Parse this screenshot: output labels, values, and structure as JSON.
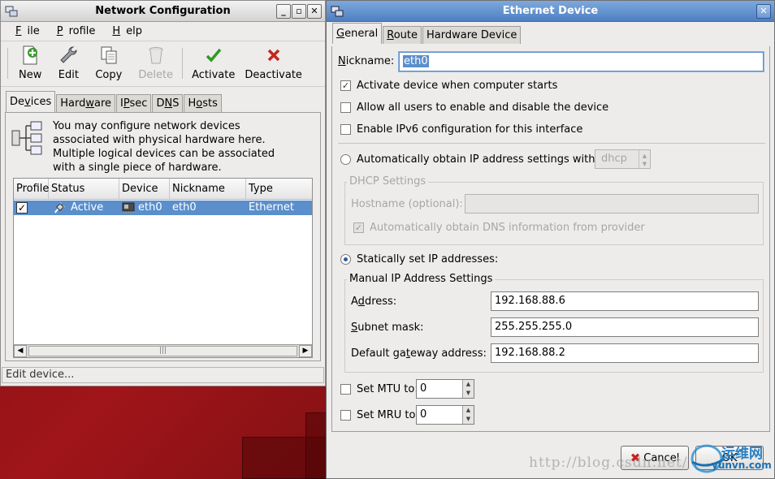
{
  "nc_window": {
    "title": "Network Configuration",
    "menu": [
      "File",
      "Profile",
      "Help"
    ],
    "toolbar": [
      {
        "label": "New",
        "icon": "new-plus-icon",
        "enabled": true
      },
      {
        "label": "Edit",
        "icon": "wrench-icon",
        "enabled": true
      },
      {
        "label": "Copy",
        "icon": "copy-icon",
        "enabled": true
      },
      {
        "label": "Delete",
        "icon": "trash-icon",
        "enabled": false
      },
      {
        "label": "Activate",
        "icon": "checkmark-icon",
        "enabled": true
      },
      {
        "label": "Deactivate",
        "icon": "red-x-icon",
        "enabled": true
      }
    ],
    "tabs": [
      "Devices",
      "Hardware",
      "IPsec",
      "DNS",
      "Hosts"
    ],
    "active_tab": "Devices",
    "info_text": "You may configure network devices\nassociated with physical hardware here.\nMultiple logical devices can be associated\nwith a single piece of hardware.",
    "columns": [
      "Profile",
      "Status",
      "Device",
      "Nickname",
      "Type"
    ],
    "rows": [
      {
        "profile_checked": true,
        "status": "Active",
        "device": "eth0",
        "nickname": "eth0",
        "type": "Ethernet"
      }
    ],
    "scroll_grip": "|||",
    "status_text": "Edit device..."
  },
  "eth_dialog": {
    "title": "Ethernet Device",
    "tabs": [
      "General",
      "Route",
      "Hardware Device"
    ],
    "active_tab": "General",
    "nickname_label": "Nickname:",
    "nickname_value": "eth0",
    "activate_on_start": {
      "label": "Activate device when computer starts",
      "checked": true
    },
    "allow_users": {
      "label": "Allow all users to enable and disable the device",
      "checked": false
    },
    "enable_ipv6": {
      "label": "Enable IPv6 configuration for this interface",
      "checked": false
    },
    "auto_ip": {
      "label": "Automatically obtain IP address settings with:",
      "selected": false,
      "method": "dhcp"
    },
    "dhcp": {
      "group_title": "DHCP Settings",
      "hostname_label": "Hostname (optional):",
      "hostname_value": "",
      "auto_dns_label": "Automatically obtain DNS information from provider",
      "auto_dns_checked": true
    },
    "static_ip": {
      "label": "Statically set IP addresses:",
      "selected": true
    },
    "manual": {
      "group_title": "Manual IP Address Settings",
      "address_label": "Address:",
      "address_value": "192.168.88.6",
      "subnet_label": "Subnet mask:",
      "subnet_value": "255.255.255.0",
      "gateway_label": "Default gateway address:",
      "gateway_value": "192.168.88.2"
    },
    "mtu": {
      "label": "Set MTU to:",
      "checked": false,
      "value": "0"
    },
    "mru": {
      "label": "Set MRU to:",
      "checked": false,
      "value": "0"
    },
    "cancel_label": "Cancel",
    "ok_label": "OK"
  },
  "watermark": "http://blog.csdn.net/",
  "logo_text": "运维网",
  "logo_sub": "yunvn.com",
  "colors": {
    "selection": "#5b8fcc",
    "titlebar_active": "#4d7fc2",
    "desktop": "#a01519"
  }
}
